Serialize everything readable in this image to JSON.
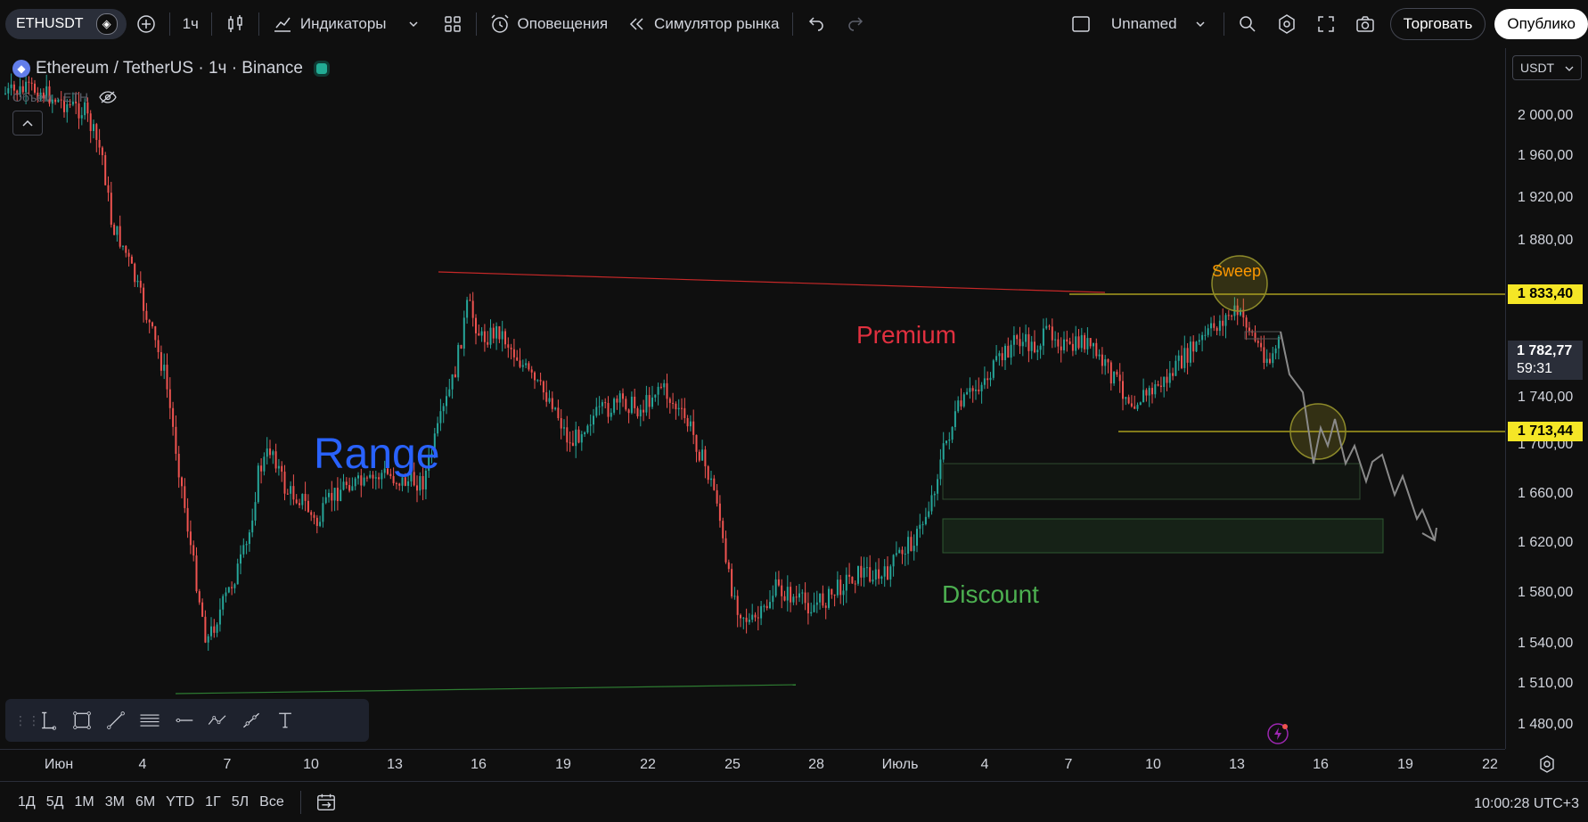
{
  "header": {
    "symbol": "ETHUSDT",
    "interval": "1ч",
    "indicators_label": "Индикаторы",
    "alerts_label": "Оповещения",
    "replay_label": "Симулятор рынка",
    "layout_name": "Unnamed",
    "trade_label": "Торговать",
    "publish_label": "Опублико"
  },
  "legend": {
    "title": "Ethereum / TetherUS · 1ч · Binance",
    "volume_label": "Объем · ETH"
  },
  "price_scale": {
    "currency": "USDT",
    "ticks": [
      "2 000,00",
      "1 960,00",
      "1 920,00",
      "1 880,00",
      "1 740,00",
      "1 700,00",
      "1 660,00",
      "1 620,00",
      "1 580,00",
      "1 540,00",
      "1 510,00",
      "1 480,00"
    ],
    "level_high": "1 833,40",
    "level_low": "1 713,44",
    "last_price": "1 782,77",
    "countdown": "59:31",
    "level_color": "#f5e626"
  },
  "time_axis": {
    "ticks": [
      "Июн",
      "4",
      "7",
      "10",
      "13",
      "16",
      "19",
      "22",
      "25",
      "28",
      "Июль",
      "4",
      "7",
      "10",
      "13",
      "16",
      "19",
      "22"
    ]
  },
  "bottom": {
    "ranges": [
      "1Д",
      "5Д",
      "1М",
      "3М",
      "6М",
      "YTD",
      "1Г",
      "5Л",
      "Все"
    ],
    "clock": "10:00:28 UTC+3"
  },
  "annotations": {
    "range": "Range",
    "premium": "Premium",
    "discount": "Discount",
    "sweep": "Sweep",
    "range_color": "#2962ff",
    "premium_color": "#e0303f",
    "discount_color": "#4caf50",
    "sweep_color": "#ff9800"
  },
  "colors": {
    "bull": "#26a69a",
    "bear": "#ef5350",
    "background": "#0f0f0f"
  }
}
